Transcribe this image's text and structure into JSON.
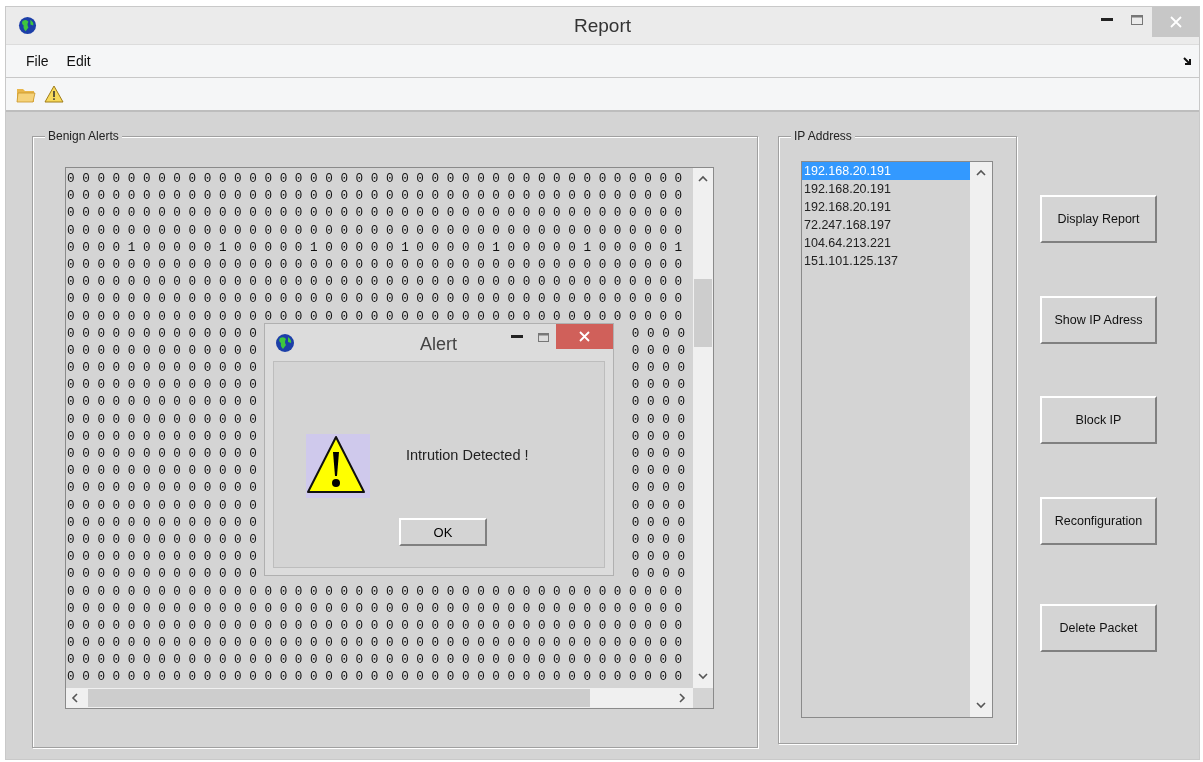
{
  "window": {
    "title": "Report"
  },
  "menu": [
    {
      "label": "File"
    },
    {
      "label": "Edit"
    }
  ],
  "benign_alerts": {
    "title": "Benign Alerts",
    "rows": [
      [
        "0 0 0 0 0 0 0 0 0 0 0 0 0 0 0 0 0 0 0 0 0 0 0 0 0 0 0 0 0 0 0 0 0 0 0 0 0 0 0 0 0"
      ],
      [
        "0 0 0 0 0 0 0 0 0 0 0 0 0 0 0 0 0 0 0 0 0 0 0 0 0 0 0 0 0 0 0 0 0 0 0 0 0 0 0 0 0"
      ],
      [
        "0 0 0 0 0 0 0 0 0 0 0 0 0 0 0 0 0 0 0 0 0 0 0 0 0 0 0 0 0 0 0 0 0 0 0 0 0 0 0 0 0"
      ],
      [
        "0 0 0 0 0 0 0 0 0 0 0 0 0 0 0 0 0 0 0 0 0 0 0 0 0 0 0 0 0 0 0 0 0 0 0 0 0 0 0 0 0"
      ],
      [
        "0 0 0 0 1 0 0 0 0 0 1 0 0 0 0 0 1 0 0 0 0 0 1 0 0 0 0 0 1 0 0 0 0 0 1 0 0 0 0 0 1"
      ],
      [
        "0 0 0 0 0 0 0 0 0 0 0 0 0 0 0 0 0 0 0 0 0 0 0 0 0 0 0 0 0 0 0 0 0 0 0 0 0 0 0 0 0"
      ],
      [
        "0 0 0 0 0 0 0 0 0 0 0 0 0 0 0 0 0 0 0 0 0 0 0 0 0 0 0 0 0 0 0 0 0 0 0 0 0 0 0 0 0"
      ],
      [
        "0 0 0 0 0 0 0 0 0 0 0 0 0 0 0 0 0 0 0 0 0 0 0 0 0 0 0 0 0 0 0 0 0 0 0 0 0 0 0 0 0"
      ],
      [
        "0 0 0 0 0 0 0 0 0 0 0 0 0 0 0 0 0 0 0 0 0 0 0 0 0 0 0 0 0 0 0 0 0 0 0 0 0 0 0 0 0"
      ],
      [
        "0 0 0 0 0 0 0 0 0 0 0 0 0",
        "0 0 0 0"
      ],
      [
        "0 0 0 0 0 0 0 0 0 0 0 0 0",
        "0 0 0 0"
      ],
      [
        "0 0 0 0 0 0 0 0 0 0 0 0 0",
        "0 0 0 0"
      ],
      [
        "0 0 0 0 0 0 0 0 0 0 0 0 0",
        "0 0 0 0"
      ],
      [
        "0 0 0 0 0 0 0 0 0 0 0 0 0",
        "0 0 0 0"
      ],
      [
        "0 0 0 0 0 0 0 0 0 0 0 0 0",
        "0 0 0 0"
      ],
      [
        "0 0 0 0 0 0 0 0 0 0 0 0 0",
        "0 0 0 0"
      ],
      [
        "0 0 0 0 0 0 0 0 0 0 0 0 0",
        "0 0 0 0"
      ],
      [
        "0 0 0 0 0 0 0 0 0 0 0 0 0",
        "0 0 0 0"
      ],
      [
        "0 0 0 0 0 0 0 0 0 0 0 0 0",
        "0 0 0 0"
      ],
      [
        "0 0 0 0 0 0 0 0 0 0 0 0 0",
        "0 0 0 0"
      ],
      [
        "0 0 0 0 0 0 0 0 0 0 0 0 0",
        "0 0 0 0"
      ],
      [
        "0 0 0 0 0 0 0 0 0 0 0 0 0",
        "0 0 0 0"
      ],
      [
        "0 0 0 0 0 0 0 0 0 0 0 0 0",
        "0 0 0 0"
      ],
      [
        "0 0 0 0 0 0 0 0 0 0 0 0 0",
        "0 0 0 0"
      ],
      [
        "0 0 0 0 0 0 0 0 0 0 0 0 0 0 0 0 0 0 0 0 0 0 0 0 0 0 0 0 0 0 0 0 0 0 0 0 0 0 0 0 0"
      ],
      [
        "0 0 0 0 0 0 0 0 0 0 0 0 0 0 0 0 0 0 0 0 0 0 0 0 0 0 0 0 0 0 0 0 0 0 0 0 0 0 0 0 0"
      ],
      [
        "0 0 0 0 0 0 0 0 0 0 0 0 0 0 0 0 0 0 0 0 0 0 0 0 0 0 0 0 0 0 0 0 0 0 0 0 0 0 0 0 0"
      ],
      [
        "0 0 0 0 0 0 0 0 0 0 0 0 0 0 0 0 0 0 0 0 0 0 0 0 0 0 0 0 0 0 0 0 0 0 0 0 0 0 0 0 0"
      ],
      [
        "0 0 0 0 0 0 0 0 0 0 0 0 0 0 0 0 0 0 0 0 0 0 0 0 0 0 0 0 0 0 0 0 0 0 0 0 0 0 0 0 0"
      ],
      [
        "0 0 0 0 0 0 0 0 0 0 0 0 0 0 0 0 0 0 0 0 0 0 0 0 0 0 0 0 0 0 0 0 0 0 0 0 0 0 0 0 0"
      ]
    ]
  },
  "ip_address": {
    "title": "IP Address",
    "items": [
      {
        "label": "192.168.20.191",
        "selected": true
      },
      {
        "label": "192.168.20.191",
        "selected": false
      },
      {
        "label": "192.168.20.191",
        "selected": false
      },
      {
        "label": "72.247.168.197",
        "selected": false
      },
      {
        "label": "104.64.213.221",
        "selected": false
      },
      {
        "label": "151.101.125.137",
        "selected": false
      }
    ]
  },
  "buttons": [
    "Display Report",
    "Show IP Adress",
    "Block IP",
    "Reconfiguration",
    "Delete Packet"
  ],
  "alert_dialog": {
    "title": "Alert",
    "message": "Intrution Detected !",
    "button": "OK"
  }
}
